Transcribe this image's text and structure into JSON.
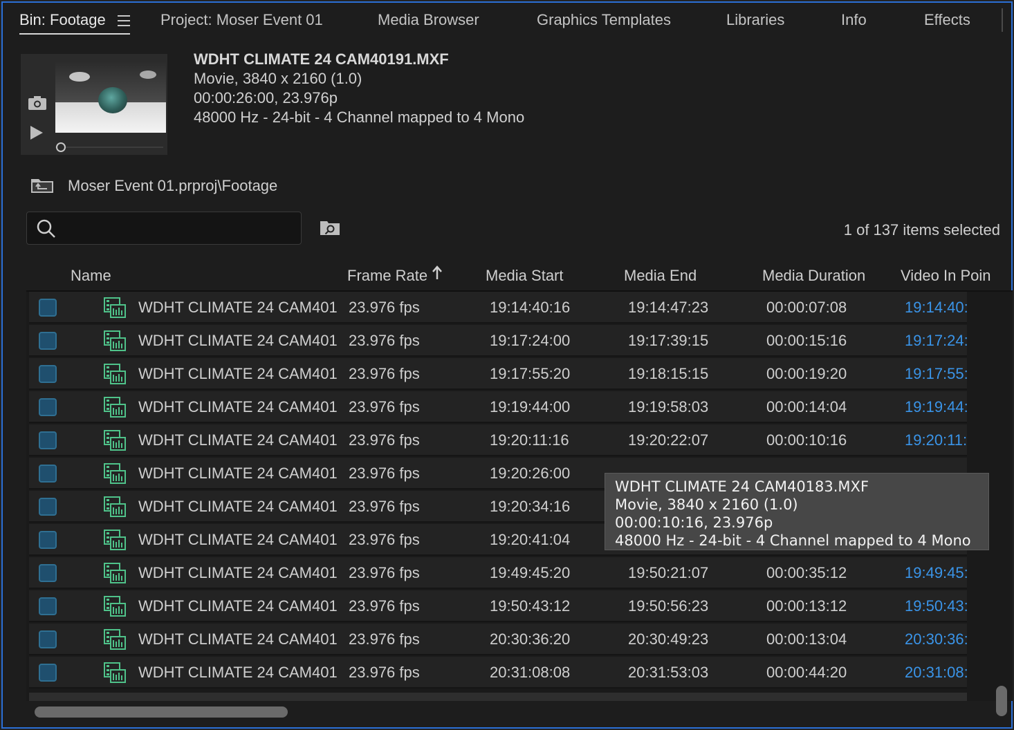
{
  "tabs": [
    {
      "label": "Bin: Footage",
      "active": true
    },
    {
      "label": "Project: Moser Event 01"
    },
    {
      "label": "Media Browser"
    },
    {
      "label": "Graphics Templates"
    },
    {
      "label": "Libraries"
    },
    {
      "label": "Info"
    },
    {
      "label": "Effects"
    }
  ],
  "clip_info": {
    "title": "WDHT CLIMATE 24 CAM40191.MXF",
    "format": "Movie, 3840 x 2160 (1.0)",
    "duration": "00:00:26:00, 23.976p",
    "audio": "48000 Hz - 24-bit - 4 Channel mapped to 4 Mono"
  },
  "bin_path": "Moser Event 01.prproj\\Footage",
  "search": {
    "value": "",
    "placeholder": ""
  },
  "items_selected": "1 of 137 items selected",
  "columns": {
    "name": "Name",
    "frame_rate": "Frame Rate",
    "media_start": "Media Start",
    "media_end": "Media End",
    "media_duration": "Media Duration",
    "video_in_point": "Video In Poin"
  },
  "sort": {
    "column": "Frame Rate",
    "direction": "ascending"
  },
  "rows": [
    {
      "name": "WDHT CLIMATE 24 CAM401",
      "fr": "23.976 fps",
      "ms": "19:14:40:16",
      "me": "19:14:47:23",
      "md": "00:00:07:08",
      "vi": "19:14:40:"
    },
    {
      "name": "WDHT CLIMATE 24 CAM401",
      "fr": "23.976 fps",
      "ms": "19:17:24:00",
      "me": "19:17:39:15",
      "md": "00:00:15:16",
      "vi": "19:17:24:"
    },
    {
      "name": "WDHT CLIMATE 24 CAM401",
      "fr": "23.976 fps",
      "ms": "19:17:55:20",
      "me": "19:18:15:15",
      "md": "00:00:19:20",
      "vi": "19:17:55:"
    },
    {
      "name": "WDHT CLIMATE 24 CAM401",
      "fr": "23.976 fps",
      "ms": "19:19:44:00",
      "me": "19:19:58:03",
      "md": "00:00:14:04",
      "vi": "19:19:44:"
    },
    {
      "name": "WDHT CLIMATE 24 CAM401",
      "fr": "23.976 fps",
      "ms": "19:20:11:16",
      "me": "19:20:22:07",
      "md": "00:00:10:16",
      "vi": "19:20:11:"
    },
    {
      "name": "WDHT CLIMATE 24 CAM401",
      "fr": "23.976 fps",
      "ms": "19:20:26:00",
      "me": "",
      "md": "",
      "vi": ""
    },
    {
      "name": "WDHT CLIMATE 24 CAM401",
      "fr": "23.976 fps",
      "ms": "19:20:34:16",
      "me": "",
      "md": "",
      "vi": ""
    },
    {
      "name": "WDHT CLIMATE 24 CAM401",
      "fr": "23.976 fps",
      "ms": "19:20:41:04",
      "me": "",
      "md": "",
      "vi": ""
    },
    {
      "name": "WDHT CLIMATE 24 CAM401",
      "fr": "23.976 fps",
      "ms": "19:49:45:20",
      "me": "19:50:21:07",
      "md": "00:00:35:12",
      "vi": "19:49:45:"
    },
    {
      "name": "WDHT CLIMATE 24 CAM401",
      "fr": "23.976 fps",
      "ms": "19:50:43:12",
      "me": "19:50:56:23",
      "md": "00:00:13:12",
      "vi": "19:50:43:"
    },
    {
      "name": "WDHT CLIMATE 24 CAM401",
      "fr": "23.976 fps",
      "ms": "20:30:36:20",
      "me": "20:30:49:23",
      "md": "00:00:13:04",
      "vi": "20:30:36:"
    },
    {
      "name": "WDHT CLIMATE 24 CAM401",
      "fr": "23.976 fps",
      "ms": "20:31:08:08",
      "me": "20:31:53:03",
      "md": "00:00:44:20",
      "vi": "20:31:08:"
    }
  ],
  "tooltip": {
    "title": "WDHT CLIMATE 24 CAM40183.MXF",
    "format": "Movie, 3840 x 2160 (1.0)",
    "duration": "00:00:10:16, 23.976p",
    "audio": "48000 Hz - 24-bit - 4 Channel mapped to 4 Mono"
  },
  "colors": {
    "accent": "#2b6fd6",
    "in_point": "#3a94e8",
    "checkbox": "#1f4f6e",
    "clip_icon": "#4fc38a"
  },
  "icons": {
    "menu": "hamburger-icon",
    "camera": "camera-icon",
    "play": "play-icon",
    "folder_up": "folder-up-icon",
    "search": "search-icon",
    "find": "find-in-bin-icon",
    "sort": "sort-ascending-icon",
    "clip": "video-clip-icon"
  }
}
